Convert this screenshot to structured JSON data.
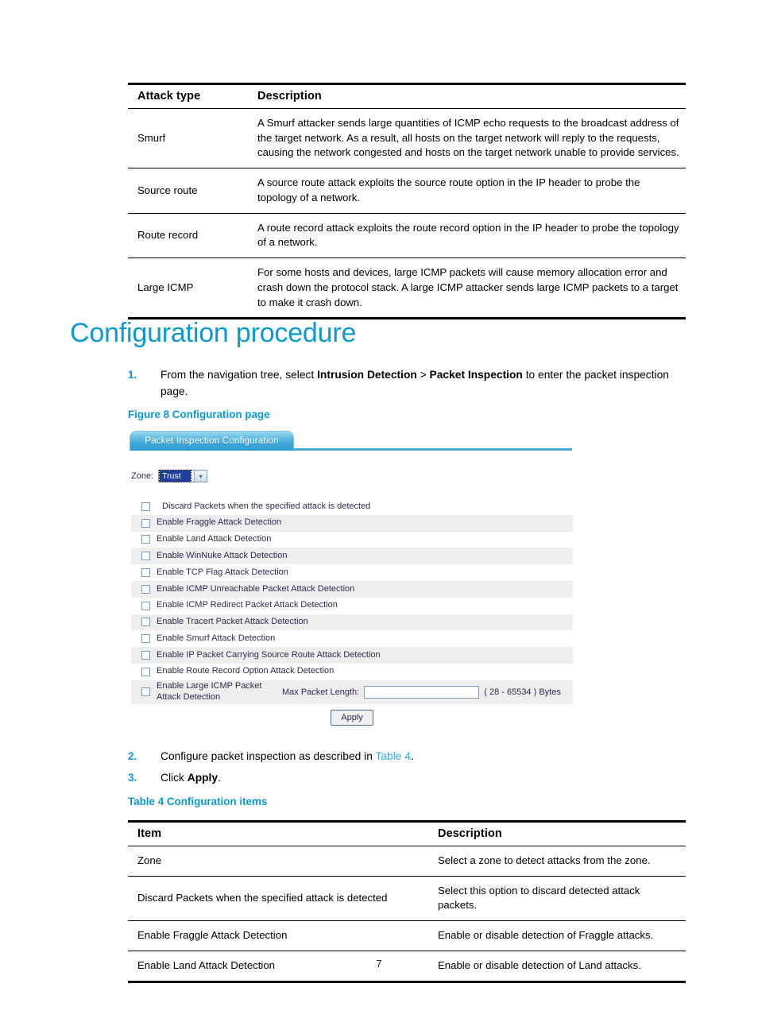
{
  "colors": {
    "heading_blue": "#0A9AD6",
    "link_blue": "#37A9DC",
    "tab_blue": "#2E9ED4",
    "select_highlight": "#1F3F9E",
    "row_shade": "#EEEEEE"
  },
  "attack_table": {
    "headers": [
      "Attack type",
      "Description"
    ],
    "rows": [
      {
        "type": "Smurf",
        "description": "A Smurf attacker sends large quantities of ICMP echo requests to the broadcast address of the target network. As a result, all hosts on the target network will reply to the requests, causing the network congested and hosts on the target network unable to provide services."
      },
      {
        "type": "Source route",
        "description": "A source route attack exploits the source route option in the IP header to probe the topology of a network."
      },
      {
        "type": "Route record",
        "description": "A route record attack exploits the route record option in the IP header to probe the topology of a network."
      },
      {
        "type": "Large ICMP",
        "description": "For some hosts and devices, large ICMP packets will cause memory allocation error and crash down the protocol stack. A large ICMP attacker sends large ICMP packets to a target to make it crash down."
      }
    ]
  },
  "section": {
    "heading": "Configuration procedure"
  },
  "steps": [
    {
      "num": "1.",
      "text_parts": [
        {
          "t": "From the navigation tree, select ",
          "style": "normal"
        },
        {
          "t": "Intrusion Detection",
          "style": "bold"
        },
        {
          "t": " > ",
          "style": "normal"
        },
        {
          "t": "Packet Inspection",
          "style": "bold"
        },
        {
          "t": " to enter the packet inspection page.",
          "style": "normal"
        }
      ],
      "plain": "From the navigation tree, select Intrusion Detection > Packet Inspection to enter the packet inspection page."
    },
    {
      "num": "2.",
      "plain": "Configure packet inspection as described in Table 4."
    },
    {
      "num": "3.",
      "plain": "Click Apply."
    }
  ],
  "step1": {
    "pre": "From the navigation tree, select ",
    "bold1": "Intrusion Detection",
    "mid": " > ",
    "bold2": "Packet Inspection",
    "post": " to enter the packet inspection page."
  },
  "step2": {
    "pre": "Configure packet inspection as described in ",
    "link": "Table 4",
    "post": "."
  },
  "step3": {
    "pre": "Click ",
    "bold": "Apply",
    "post": "."
  },
  "figure_caption": "Figure 8 Configuration page",
  "table_caption": "Table 4 Configuration items",
  "screenshot": {
    "tab_label": "Packet Inspection Configuration",
    "zone": {
      "label": "Zone:",
      "selected": "Trust",
      "arrow_icon": "chevron-down-icon"
    },
    "checkboxes": [
      {
        "label": "Discard Packets when the specified attack is detected",
        "checked": false,
        "shaded": false,
        "indent": true
      },
      {
        "label": "Enable Fraggle Attack Detection",
        "checked": false,
        "shaded": true
      },
      {
        "label": "Enable Land Attack Detection",
        "checked": false,
        "shaded": false
      },
      {
        "label": "Enable WinNuke Attack Detection",
        "checked": false,
        "shaded": true
      },
      {
        "label": "Enable TCP Flag Attack Detection",
        "checked": false,
        "shaded": false
      },
      {
        "label": "Enable ICMP Unreachable Packet Attack Detection",
        "checked": false,
        "shaded": true
      },
      {
        "label": "Enable ICMP Redirect Packet Attack Detection",
        "checked": false,
        "shaded": false
      },
      {
        "label": "Enable Tracert Packet Attack Detection",
        "checked": false,
        "shaded": true
      },
      {
        "label": "Enable Smurf Attack Detection",
        "checked": false,
        "shaded": false
      },
      {
        "label": "Enable IP Packet Carrying Source Route Attack Detection",
        "checked": false,
        "shaded": true
      },
      {
        "label": "Enable Route Record Option Attack Detection",
        "checked": false,
        "shaded": false
      }
    ],
    "large_icmp_row": {
      "label": "Enable Large ICMP Packet Attack Detection",
      "checked": false,
      "shaded": true,
      "max_len_label": "Max Packet Length:",
      "max_len_value": "",
      "max_len_placeholder": "",
      "hint": "( 28 - 65534 ) Bytes"
    },
    "apply_label": "Apply"
  },
  "config_table": {
    "headers": [
      "Item",
      "Description"
    ],
    "rows": [
      {
        "item": "Zone",
        "description": "Select a zone to detect attacks from the zone."
      },
      {
        "item": "Discard Packets when the specified attack is detected",
        "description": "Select this option to discard detected attack packets."
      },
      {
        "item": "Enable Fraggle Attack Detection",
        "description": "Enable or disable detection of Fraggle attacks."
      },
      {
        "item": "Enable Land Attack Detection",
        "description": "Enable or disable detection of Land attacks."
      }
    ]
  },
  "page_number": "7"
}
